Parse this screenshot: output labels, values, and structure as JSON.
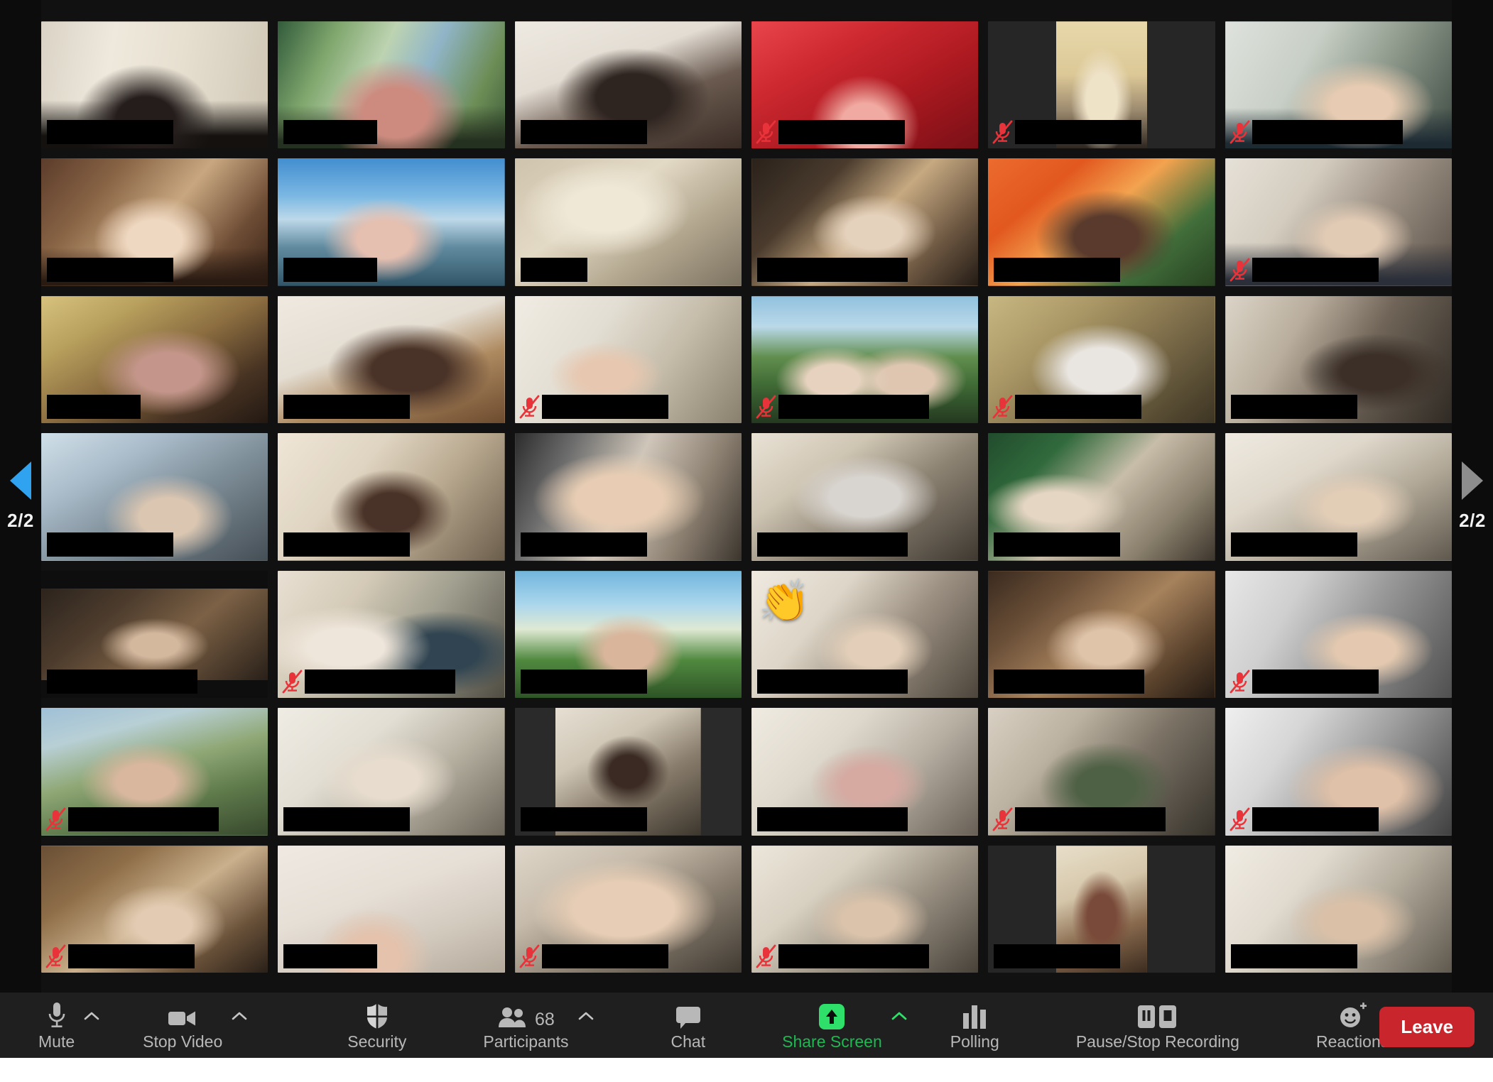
{
  "app": {
    "view": "Gallery View",
    "accent_green": "#1eb853",
    "leave_red": "#c8252c",
    "active_speaker_border": "#d8e26a",
    "muted_red": "#e8333a",
    "toolbar_bg": "#1f1f1f",
    "stage_bg": "#111111"
  },
  "pagination": {
    "prev_label": "2/2",
    "next_label": "2/2",
    "prev_icon": "triangle-left-icon",
    "next_icon": "triangle-right-icon",
    "prev_color": "#2fa3f0",
    "next_color": "#8d8d8d"
  },
  "grid": {
    "columns": 6,
    "rows": 7,
    "tiles": [
      {
        "id": 1,
        "row": 1,
        "col": 1,
        "muted": false,
        "speaking": false,
        "name_width": "w-lg",
        "fit": "full",
        "reaction": null,
        "bg": "linear-gradient(100deg,#d9d2c4 0%,#efe9dc 30%,#e7e0d0 58%,#cfc6b4 100%)",
        "overlay": "radial-gradient(ellipse at 46% 78%, #241d1c 0 17%, transparent 40%), linear-gradient(180deg, transparent 62%, #14110f 90%)"
      },
      {
        "id": 2,
        "row": 1,
        "col": 2,
        "muted": false,
        "speaking": false,
        "name_width": "w-md",
        "fit": "full",
        "reaction": null,
        "bg": "linear-gradient(115deg,#2f5b3a 0%,#7fa86b 22%,#bcd3b0 42%,#8fb5c9 60%,#6d8f55 82%,#3b5c37 100%)",
        "overlay": "radial-gradient(ellipse at 52% 72%, #d08a7e 0 19%, transparent 42%), linear-gradient(180deg, transparent 66%, #24301f 94%)"
      },
      {
        "id": 3,
        "row": 1,
        "col": 3,
        "muted": false,
        "speaking": false,
        "name_width": "w-lg",
        "fit": "full",
        "reaction": null,
        "bg": "linear-gradient(160deg,#efeae1 0%,#e2dcd2 36%,#6b5a4e 62%,#3a2c24 100%)",
        "overlay": "radial-gradient(ellipse at 52% 60%, #2e2420 0 22%, transparent 46%)"
      },
      {
        "id": 4,
        "row": 1,
        "col": 4,
        "muted": true,
        "speaking": false,
        "name_width": "w-lg",
        "fit": "full",
        "reaction": null,
        "bg": "linear-gradient(150deg,#f0434b 0%,#d52730 30%,#b2171f 62%,#7e0f16 100%)",
        "overlay": "radial-gradient(ellipse at 50% 82%, #f4a9a0 0 15%, transparent 34%)"
      },
      {
        "id": 5,
        "row": 1,
        "col": 5,
        "muted": true,
        "speaking": false,
        "name_width": "w-lg",
        "fit": "pillar-wide",
        "reaction": null,
        "bg": "linear-gradient(180deg,#e9d9a8 0%,#ddc894 42%,#9d8a6d 70%,#2d2620 100%)",
        "overlay": "radial-gradient(ellipse at 50% 62%, #efe2c6 0 24%, transparent 48%)"
      },
      {
        "id": 6,
        "row": 1,
        "col": 6,
        "muted": true,
        "speaking": false,
        "name_width": "w-xl",
        "fit": "full",
        "reaction": null,
        "bg": "linear-gradient(120deg,#dfe2dd 0%,#c8cfc6 34%,#8f9a8c 62%,#3d4a42 100%)",
        "overlay": "radial-gradient(ellipse at 60% 66%, #e8cbb0 0 16%, transparent 38%), linear-gradient(180deg, transparent 68%, #1c2a33 96%)"
      },
      {
        "id": 7,
        "row": 2,
        "col": 1,
        "muted": false,
        "speaking": false,
        "name_width": "w-lg",
        "fit": "full",
        "reaction": null,
        "bg": "linear-gradient(130deg,#5c3c2a 0%,#8b6443 26%,#c9a77e 52%,#6e4c33 78%,#3a2418 100%)",
        "overlay": "radial-gradient(ellipse at 50% 64%, #f0d8c0 0 17%, transparent 38%), linear-gradient(180deg, transparent 70%, #2a1a11 96%)"
      },
      {
        "id": 8,
        "row": 2,
        "col": 2,
        "muted": false,
        "speaking": false,
        "name_width": "w-md",
        "fit": "full",
        "reaction": null,
        "bg": "linear-gradient(180deg,#3f8fd4 0%,#79b9e6 30%,#bcd9ea 48%,#5e8aa0 70%,#2f5568 100%)",
        "overlay": "radial-gradient(ellipse at 47% 64%, #e7bfae 0 16%, transparent 36%)"
      },
      {
        "id": 9,
        "row": 2,
        "col": 3,
        "muted": false,
        "speaking": false,
        "name_width": "w-sm",
        "fit": "full",
        "reaction": null,
        "bg": "linear-gradient(145deg,#cfc3ab 0%,#e3dac5 38%,#b5a88f 66%,#7d7260 100%)",
        "overlay": "radial-gradient(ellipse at 40% 40%, #efe8d6 0 20%, transparent 44%)"
      },
      {
        "id": 10,
        "row": 2,
        "col": 4,
        "muted": false,
        "speaking": false,
        "name_width": "w-xl",
        "fit": "full",
        "reaction": null,
        "bg": "linear-gradient(135deg,#2a211a 0%,#4b3b2c 28%,#c7a97f 52%,#6b553f 78%,#241b14 100%)",
        "overlay": "radial-gradient(ellipse at 54% 58%, #e6d2bc 0 16%, transparent 36%)"
      },
      {
        "id": 11,
        "row": 2,
        "col": 5,
        "muted": false,
        "speaking": false,
        "name_width": "w-lg",
        "fit": "full",
        "reaction": null,
        "bg": "linear-gradient(140deg,#f26a2a 0%,#e8571b 26%,#f7a24a 48%,#3f6f38 74%,#27421f 100%)",
        "overlay": "radial-gradient(ellipse at 52% 62%, #5a3a2b 0 19%, transparent 42%)"
      },
      {
        "id": 12,
        "row": 2,
        "col": 6,
        "muted": true,
        "speaking": false,
        "name_width": "w-lg",
        "fit": "full",
        "reaction": null,
        "bg": "linear-gradient(125deg,#e6e1d7 0%,#d3ccbe 32%,#9d9183 60%,#584e44 100%)",
        "overlay": "radial-gradient(ellipse at 56% 62%, #e3cbb4 0 15%, transparent 34%), linear-gradient(180deg, transparent 66%, #2b2f3a 95%)"
      },
      {
        "id": 13,
        "row": 3,
        "col": 1,
        "muted": false,
        "speaking": false,
        "name_width": "w-md",
        "fit": "full",
        "reaction": null,
        "bg": "linear-gradient(150deg,#d8c27a 0%,#b9a05a 24%,#8d6e3e 50%,#4a3422 76%,#231811 100%)",
        "overlay": "radial-gradient(ellipse at 56% 60%, #c6968a 0 18%, transparent 40%)"
      },
      {
        "id": 14,
        "row": 3,
        "col": 2,
        "muted": false,
        "speaking": true,
        "name_width": "w-lg",
        "fit": "full",
        "reaction": null,
        "bg": "linear-gradient(160deg,#efe9df 0%,#e4ddd1 40%,#b08a5e 64%,#6d4a2c 100%)",
        "overlay": "radial-gradient(ellipse at 58% 58%, #4a3226 0 20%, transparent 44%)"
      },
      {
        "id": 15,
        "row": 3,
        "col": 3,
        "muted": true,
        "speaking": false,
        "name_width": "w-lg",
        "fit": "full",
        "reaction": null,
        "bg": "linear-gradient(125deg,#f1ece2 0%,#e3ded2 34%,#c6bdaa 62%,#8a7f6c 100%)",
        "overlay": "radial-gradient(ellipse at 40% 62%, #e9c7ae 0 13%, transparent 30%)"
      },
      {
        "id": 16,
        "row": 3,
        "col": 4,
        "muted": true,
        "speaking": false,
        "name_width": "w-xl",
        "fit": "full",
        "reaction": null,
        "bg": "linear-gradient(180deg,#8fc1e0 0%,#b9d9ea 24%,#5f8f4c 48%,#3d6b33 70%,#23381f 100%)",
        "overlay": "radial-gradient(ellipse at 36% 66%, #e7d2bd 0 13%, transparent 28%), radial-gradient(ellipse at 68% 66%, #dfc6b0 0 13%, transparent 28%)"
      },
      {
        "id": 17,
        "row": 3,
        "col": 5,
        "muted": true,
        "speaking": false,
        "name_width": "w-lg",
        "fit": "full",
        "reaction": null,
        "bg": "linear-gradient(140deg,#c8b77e 0%,#ab9763 30%,#7d6c47 60%,#3c3422 100%)",
        "overlay": "radial-gradient(ellipse at 50% 58%, #e9e5e0 0 21%, transparent 44%)"
      },
      {
        "id": 18,
        "row": 3,
        "col": 6,
        "muted": false,
        "speaking": false,
        "name_width": "w-lg",
        "fit": "full",
        "reaction": null,
        "bg": "linear-gradient(120deg,#dbd4c6 0%,#b9ae9c 30%,#6f6456 58%,#2f2a24 100%)",
        "overlay": "radial-gradient(ellipse at 66% 60%, #3c2f28 0 16%, transparent 36%)"
      },
      {
        "id": 19,
        "row": 4,
        "col": 1,
        "muted": false,
        "speaking": false,
        "name_width": "w-lg",
        "fit": "full",
        "reaction": null,
        "bg": "linear-gradient(150deg,#cfe0ea 0%,#a9bccb 28%,#7d8e99 56%,#444e55 100%)",
        "overlay": "radial-gradient(ellipse at 56% 66%, #dcc6b0 0 16%, transparent 36%)"
      },
      {
        "id": 20,
        "row": 4,
        "col": 2,
        "muted": false,
        "speaking": false,
        "name_width": "w-lg",
        "fit": "full",
        "reaction": null,
        "bg": "linear-gradient(130deg,#efe6d6 0%,#e0d4c0 34%,#b9a88e 62%,#6b5d4a 100%)",
        "overlay": "radial-gradient(ellipse at 50% 62%, #4a3226 0 17%, transparent 38%)"
      },
      {
        "id": 21,
        "row": 4,
        "col": 3,
        "muted": false,
        "speaking": false,
        "name_width": "w-lg",
        "fit": "full",
        "reaction": null,
        "bg": "linear-gradient(115deg,#2c2c2c 0%,#6d6d6d 22%,#cfc6b8 48%,#8f8272 74%,#3a352d 100%)",
        "overlay": "radial-gradient(ellipse at 46% 52%, #e9cdb2 0 25%, transparent 50%)"
      },
      {
        "id": 22,
        "row": 4,
        "col": 4,
        "muted": false,
        "speaking": false,
        "name_width": "w-xl",
        "fit": "full",
        "reaction": null,
        "bg": "linear-gradient(145deg,#e9e2d4 0%,#cfc5b2 30%,#8d8372 58%,#3e3830 100%)",
        "overlay": "radial-gradient(ellipse at 50% 50%, #d8d4cf 0 22%, transparent 46%)"
      },
      {
        "id": 23,
        "row": 4,
        "col": 5,
        "muted": false,
        "speaking": false,
        "name_width": "w-lg",
        "fit": "full",
        "reaction": null,
        "bg": "linear-gradient(135deg,#1f4d2c 0%,#2f6b3a 24%,#c7bda8 50%,#8a7f6b 76%,#3d362c 100%)",
        "overlay": "radial-gradient(ellipse at 30% 58%, #e6d6c2 0 14%, transparent 32%)"
      },
      {
        "id": 24,
        "row": 4,
        "col": 6,
        "muted": false,
        "speaking": false,
        "name_width": "w-lg",
        "fit": "full",
        "reaction": null,
        "bg": "linear-gradient(150deg,#efeae0 0%,#ded7c9 34%,#b1a896 62%,#5e574c 100%)",
        "overlay": "radial-gradient(ellipse at 56% 58%, #e3cdb6 0 16%, transparent 36%)"
      },
      {
        "id": 25,
        "row": 5,
        "col": 1,
        "muted": false,
        "speaking": false,
        "name_width": "w-xl",
        "fit": "letterbox",
        "reaction": null,
        "bg": "linear-gradient(140deg,#2c231c 0%,#4e3c2c 30%,#7d6144 58%,#2a2018 100%)",
        "overlay": "radial-gradient(ellipse at 50% 62%, #d4b89c 0 15%, transparent 34%)"
      },
      {
        "id": 26,
        "row": 5,
        "col": 2,
        "muted": true,
        "speaking": false,
        "name_width": "w-xl",
        "fit": "full",
        "reaction": null,
        "bg": "linear-gradient(125deg,#e8e0d2 0%,#d4cab6 30%,#a2a08f 58%,#4f4c42 100%)",
        "overlay": "radial-gradient(ellipse at 30% 60%, #efe6da 0 17%, transparent 38%), radial-gradient(ellipse at 72% 64%, #2f4452 0 16%, transparent 36%)"
      },
      {
        "id": 27,
        "row": 5,
        "col": 3,
        "muted": false,
        "speaking": false,
        "name_width": "w-lg",
        "fit": "full",
        "reaction": null,
        "bg": "linear-gradient(180deg,#6fb6e0 0%,#a8d6ee 26%,#dfe9d2 46%,#4e8a3c 70%,#2c5524 100%)",
        "overlay": "radial-gradient(ellipse at 50% 64%, #dbb59a 0 15%, transparent 34%)"
      },
      {
        "id": 28,
        "row": 5,
        "col": 4,
        "muted": false,
        "speaking": false,
        "name_width": "w-xl",
        "fit": "full",
        "reaction": "clap-emoji",
        "bg": "linear-gradient(130deg,#efe9df 0%,#ddd5c6 32%,#9d9182 60%,#4c453a 100%)",
        "overlay": "radial-gradient(ellipse at 54% 62%, #e4cfb8 0 15%, transparent 34%)"
      },
      {
        "id": 29,
        "row": 5,
        "col": 5,
        "muted": false,
        "speaking": false,
        "name_width": "w-xl",
        "fit": "full",
        "reaction": null,
        "bg": "linear-gradient(140deg,#3b2a1e 0%,#6b4f36 26%,#a8825a 52%,#5c432c 78%,#241a12 100%)",
        "overlay": "radial-gradient(ellipse at 52% 60%, #e0c4a8 0 16%, transparent 36%)"
      },
      {
        "id": 30,
        "row": 5,
        "col": 6,
        "muted": true,
        "speaking": false,
        "name_width": "w-lg",
        "fit": "full",
        "reaction": null,
        "bg": "linear-gradient(120deg,#e7e7e7 0%,#cfcfcf 28%,#9a9a9a 56%,#4f4f4f 100%)",
        "overlay": "radial-gradient(ellipse at 62% 62%, #e5c9ae 0 15%, transparent 34%)"
      },
      {
        "id": 31,
        "row": 6,
        "col": 1,
        "muted": true,
        "speaking": false,
        "name_width": "w-xl",
        "fit": "full",
        "reaction": null,
        "bg": "linear-gradient(165deg,#9ec0d8 0%,#b7cfd6 22%,#8fa874 46%,#5e7a49 70%,#36482c 100%)",
        "overlay": "radial-gradient(ellipse at 46% 58%, #d9b79c 0 17%, transparent 38%)"
      },
      {
        "id": 32,
        "row": 6,
        "col": 2,
        "muted": false,
        "speaking": false,
        "name_width": "w-lg",
        "fit": "full",
        "reaction": null,
        "bg": "linear-gradient(140deg,#efece4 0%,#e2ded2 34%,#b6b0a0 62%,#6a6458 100%)",
        "overlay": "radial-gradient(ellipse at 48% 56%, #e7dccd 0 19%, transparent 42%)"
      },
      {
        "id": 33,
        "row": 6,
        "col": 3,
        "muted": false,
        "speaking": false,
        "name_width": "w-lg",
        "fit": "pillar",
        "reaction": null,
        "bg": "linear-gradient(150deg,#e6dfd2 0%,#cfc6b4 32%,#8a7e6c 60%,#3c362c 100%)",
        "overlay": "radial-gradient(ellipse at 50% 50%, #3b2a22 0 18%, transparent 40%)"
      },
      {
        "id": 34,
        "row": 6,
        "col": 4,
        "muted": false,
        "speaking": false,
        "name_width": "w-xl",
        "fit": "full",
        "reaction": null,
        "bg": "linear-gradient(135deg,#f0ebe0 0%,#ded8cb 34%,#b6aea0 62%,#675f54 100%)",
        "overlay": "radial-gradient(ellipse at 52% 60%, #d8a9a0 0 16%, transparent 36%)"
      },
      {
        "id": 35,
        "row": 6,
        "col": 5,
        "muted": true,
        "speaking": false,
        "name_width": "w-xl",
        "fit": "full",
        "reaction": null,
        "bg": "linear-gradient(130deg,#d8d0c2 0%,#bcb2a0 30%,#7c7365 58%,#35312a 100%)",
        "overlay": "radial-gradient(ellipse at 52% 62%, #4e6144 0 18%, transparent 40%)"
      },
      {
        "id": 36,
        "row": 6,
        "col": 6,
        "muted": true,
        "speaking": false,
        "name_width": "w-lg",
        "fit": "full",
        "reaction": null,
        "bg": "linear-gradient(125deg,#efefef 0%,#d6d6d6 28%,#a0a0a0 56%,#3f3f3f 100%)",
        "overlay": "radial-gradient(ellipse at 62% 64%, #e0c0a6 0 18%, transparent 40%)"
      },
      {
        "id": 37,
        "row": 7,
        "col": 1,
        "muted": true,
        "speaking": false,
        "name_width": "w-lg",
        "fit": "full",
        "reaction": null,
        "bg": "linear-gradient(145deg,#6b4f33 0%,#8f6e47 26%,#cbb08a 52%,#6a5138 78%,#2b2017 100%)",
        "overlay": "radial-gradient(ellipse at 54% 62%, #e3cbb0 0 16%, transparent 36%)"
      },
      {
        "id": 38,
        "row": 7,
        "col": 2,
        "muted": false,
        "speaking": false,
        "name_width": "w-md",
        "fit": "full",
        "reaction": null,
        "bg": "linear-gradient(160deg,#efe9e2 0%,#e6dfd6 40%,#d2c9bc 70%,#b3a99a 100%)",
        "overlay": "radial-gradient(ellipse at 42% 88%, #e5c2ab 0 14%, transparent 32%)"
      },
      {
        "id": 39,
        "row": 7,
        "col": 3,
        "muted": true,
        "speaking": false,
        "name_width": "w-lg",
        "fit": "full",
        "reaction": null,
        "bg": "linear-gradient(150deg,#dfd6c8 0%,#c6bbaa 32%,#8d8272 60%,#403a31 100%)",
        "overlay": "radial-gradient(ellipse at 48% 50%, #e8cdb4 0 30%, transparent 56%)"
      },
      {
        "id": 40,
        "row": 7,
        "col": 4,
        "muted": true,
        "speaking": false,
        "name_width": "w-xl",
        "fit": "full",
        "reaction": null,
        "bg": "linear-gradient(140deg,#ece6da 0%,#d8d0c0 32%,#9a9182 60%,#474138 100%)",
        "overlay": "radial-gradient(ellipse at 52% 58%, #dcc3aa 0 16%, transparent 36%)"
      },
      {
        "id": 41,
        "row": 7,
        "col": 5,
        "muted": false,
        "speaking": false,
        "name_width": "w-lg",
        "fit": "pillar-wide",
        "reaction": null,
        "bg": "linear-gradient(160deg,#e9dfc9 0%,#d6c6a8 36%,#8a6a4c 66%,#3c2b1e 100%)",
        "overlay": "radial-gradient(ellipse at 50% 56%, #7b4a38 0 22%, transparent 46%)"
      },
      {
        "id": 42,
        "row": 7,
        "col": 6,
        "muted": false,
        "speaking": false,
        "name_width": "w-lg",
        "fit": "full",
        "reaction": null,
        "bg": "linear-gradient(130deg,#f1ece2 0%,#e0dace 32%,#b4ac9c 60%,#5f584d 100%)",
        "overlay": "radial-gradient(ellipse at 56% 60%, #dcc0a6 0 16%, transparent 36%)"
      }
    ]
  },
  "toolbar": {
    "mute": {
      "label": "Mute",
      "icon": "microphone-icon",
      "has_caret": true
    },
    "stop_video": {
      "label": "Stop Video",
      "icon": "video-camera-icon",
      "has_caret": true
    },
    "security": {
      "label": "Security",
      "icon": "shield-icon",
      "has_caret": false
    },
    "participants": {
      "label": "Participants",
      "icon": "people-icon",
      "count": "68",
      "has_caret": true
    },
    "chat": {
      "label": "Chat",
      "icon": "speech-bubble-icon",
      "has_caret": false
    },
    "share_screen": {
      "label": "Share Screen",
      "icon": "share-screen-arrow-icon",
      "has_caret": true
    },
    "polling": {
      "label": "Polling",
      "icon": "bar-chart-icon",
      "has_caret": false
    },
    "recording": {
      "label": "Pause/Stop Recording",
      "icon": "pause-stop-icon",
      "has_caret": false
    },
    "reactions": {
      "label": "Reactions",
      "icon": "smiley-plus-icon",
      "has_caret": false
    },
    "leave": {
      "label": "Leave"
    }
  }
}
